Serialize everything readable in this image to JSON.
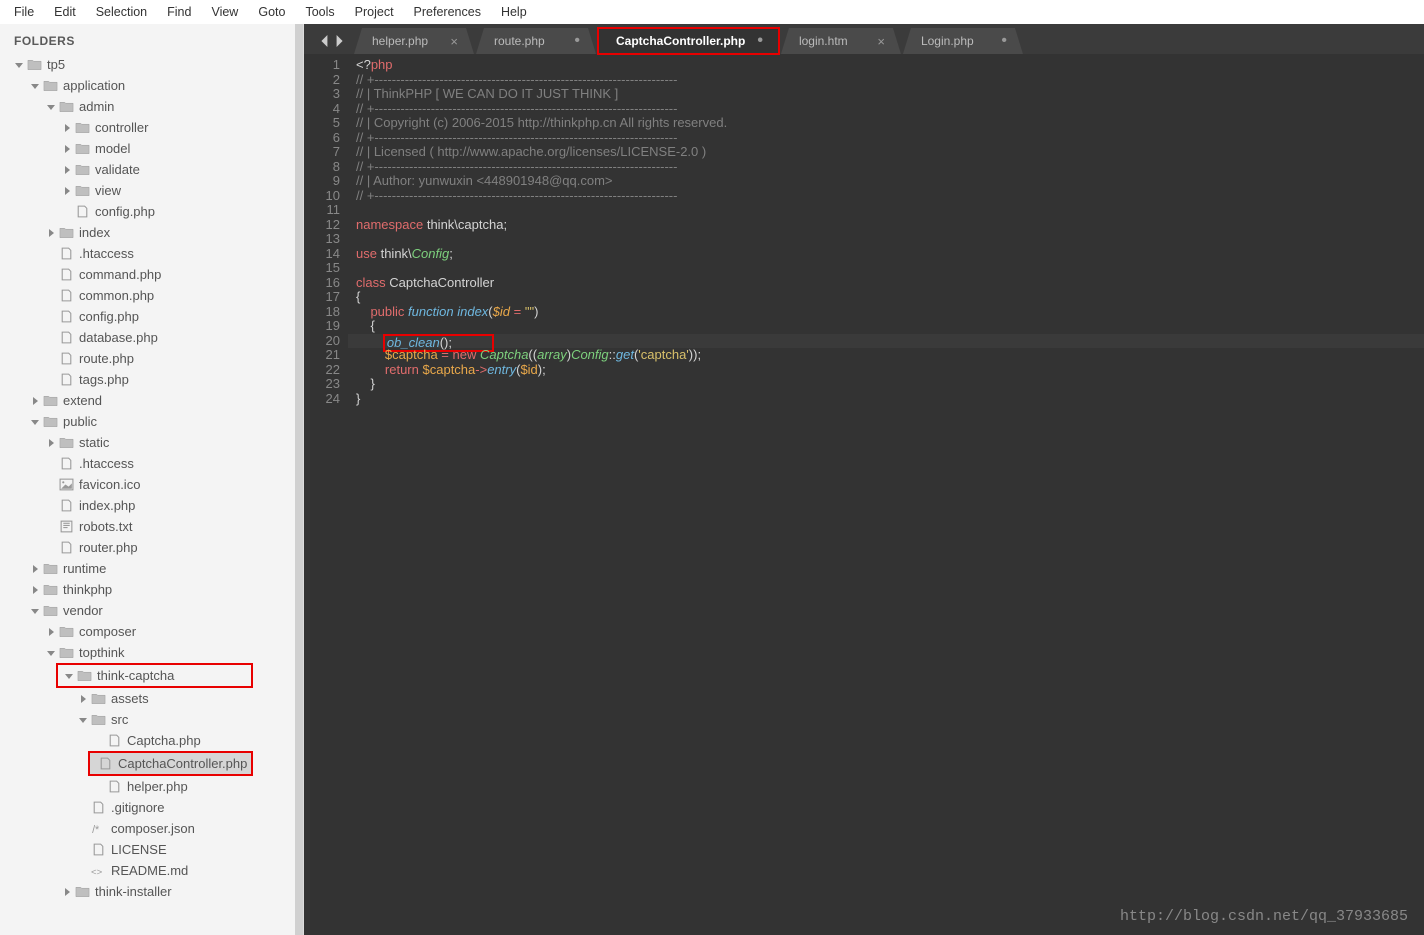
{
  "menu": [
    "File",
    "Edit",
    "Selection",
    "Find",
    "View",
    "Goto",
    "Tools",
    "Project",
    "Preferences",
    "Help"
  ],
  "sidebar": {
    "title": "FOLDERS",
    "tree": [
      {
        "d": 0,
        "t": "folder",
        "open": true,
        "label": "tp5"
      },
      {
        "d": 1,
        "t": "folder",
        "open": true,
        "label": "application"
      },
      {
        "d": 2,
        "t": "folder",
        "open": true,
        "label": "admin"
      },
      {
        "d": 3,
        "t": "folder",
        "open": false,
        "label": "controller"
      },
      {
        "d": 3,
        "t": "folder",
        "open": false,
        "label": "model"
      },
      {
        "d": 3,
        "t": "folder",
        "open": false,
        "label": "validate"
      },
      {
        "d": 3,
        "t": "folder",
        "open": false,
        "label": "view"
      },
      {
        "d": 3,
        "t": "file",
        "icon": "php",
        "label": "config.php"
      },
      {
        "d": 2,
        "t": "folder",
        "open": false,
        "label": "index"
      },
      {
        "d": 2,
        "t": "file",
        "icon": "file",
        "label": ".htaccess"
      },
      {
        "d": 2,
        "t": "file",
        "icon": "php",
        "label": "command.php"
      },
      {
        "d": 2,
        "t": "file",
        "icon": "php",
        "label": "common.php"
      },
      {
        "d": 2,
        "t": "file",
        "icon": "php",
        "label": "config.php"
      },
      {
        "d": 2,
        "t": "file",
        "icon": "php",
        "label": "database.php"
      },
      {
        "d": 2,
        "t": "file",
        "icon": "php",
        "label": "route.php"
      },
      {
        "d": 2,
        "t": "file",
        "icon": "php",
        "label": "tags.php"
      },
      {
        "d": 1,
        "t": "folder",
        "open": false,
        "label": "extend"
      },
      {
        "d": 1,
        "t": "folder",
        "open": true,
        "label": "public"
      },
      {
        "d": 2,
        "t": "folder",
        "open": false,
        "label": "static"
      },
      {
        "d": 2,
        "t": "file",
        "icon": "file",
        "label": ".htaccess"
      },
      {
        "d": 2,
        "t": "file",
        "icon": "img",
        "label": "favicon.ico"
      },
      {
        "d": 2,
        "t": "file",
        "icon": "php",
        "label": "index.php"
      },
      {
        "d": 2,
        "t": "file",
        "icon": "txt",
        "label": "robots.txt"
      },
      {
        "d": 2,
        "t": "file",
        "icon": "php",
        "label": "router.php"
      },
      {
        "d": 1,
        "t": "folder",
        "open": false,
        "label": "runtime"
      },
      {
        "d": 1,
        "t": "folder",
        "open": false,
        "label": "thinkphp"
      },
      {
        "d": 1,
        "t": "folder",
        "open": true,
        "label": "vendor"
      },
      {
        "d": 2,
        "t": "folder",
        "open": false,
        "label": "composer"
      },
      {
        "d": 2,
        "t": "folder",
        "open": true,
        "label": "topthink"
      },
      {
        "d": 3,
        "t": "folder",
        "open": true,
        "label": "think-captcha",
        "hl": true
      },
      {
        "d": 4,
        "t": "folder",
        "open": false,
        "label": "assets"
      },
      {
        "d": 4,
        "t": "folder",
        "open": true,
        "label": "src"
      },
      {
        "d": 5,
        "t": "file",
        "icon": "php",
        "label": "Captcha.php"
      },
      {
        "d": 5,
        "t": "file",
        "icon": "php",
        "label": "CaptchaController.php",
        "sel": true,
        "hl": true
      },
      {
        "d": 5,
        "t": "file",
        "icon": "php",
        "label": "helper.php"
      },
      {
        "d": 4,
        "t": "file",
        "icon": "file",
        "label": ".gitignore"
      },
      {
        "d": 4,
        "t": "file",
        "icon": "comment",
        "label": "composer.json"
      },
      {
        "d": 4,
        "t": "file",
        "icon": "file",
        "label": "LICENSE"
      },
      {
        "d": 4,
        "t": "file",
        "icon": "md",
        "label": "README.md"
      },
      {
        "d": 3,
        "t": "folder",
        "open": false,
        "label": "think-installer"
      }
    ]
  },
  "tabs": [
    {
      "label": "helper.php",
      "close": true
    },
    {
      "label": "route.php",
      "dirty": true
    },
    {
      "label": "CaptchaController.php",
      "active": true,
      "dirty": true,
      "hl": true
    },
    {
      "label": "login.htm",
      "close": true
    },
    {
      "label": "Login.php",
      "dirty": true
    }
  ],
  "code": {
    "lines": 24,
    "current": 20
  },
  "watermark": "http://blog.csdn.net/qq_37933685"
}
